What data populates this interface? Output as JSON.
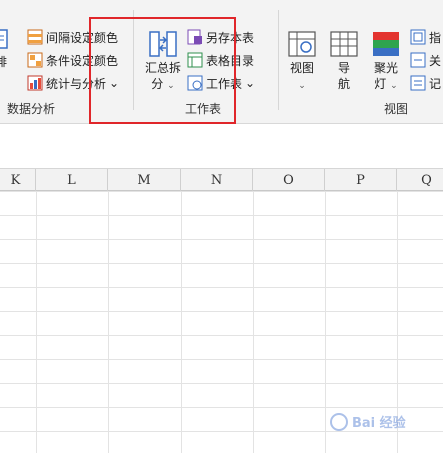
{
  "ribbon": {
    "left_partial": {
      "label_top": "",
      "label_bottom": "排"
    },
    "data_analysis": {
      "items": [
        {
          "label": "间隔设定颜色"
        },
        {
          "label": "条件设定颜色"
        },
        {
          "label": "统计与分析"
        }
      ],
      "group_label": "数据分析"
    },
    "worksheet": {
      "summarize_split": {
        "line1": "汇总拆",
        "line2": "分"
      },
      "items": [
        {
          "label": "另存本表"
        },
        {
          "label": "表格目录"
        },
        {
          "label": "工作表"
        }
      ],
      "group_label": "工作表"
    },
    "view": {
      "buttons": [
        {
          "label": "视图"
        },
        {
          "line1": "导",
          "line2": "航"
        },
        {
          "line1": "聚光",
          "line2": "灯"
        }
      ],
      "right_items": [
        {
          "label": "指"
        },
        {
          "label": "关"
        },
        {
          "label": "记"
        }
      ],
      "group_label": "视图"
    }
  },
  "columns": [
    "K",
    "L",
    "M",
    "N",
    "O",
    "P",
    "Q"
  ],
  "watermark": {
    "text": "Bai 经验"
  },
  "colors": {
    "highlight": "#e0262a",
    "ribbon_bg": "#f3f3f3"
  }
}
